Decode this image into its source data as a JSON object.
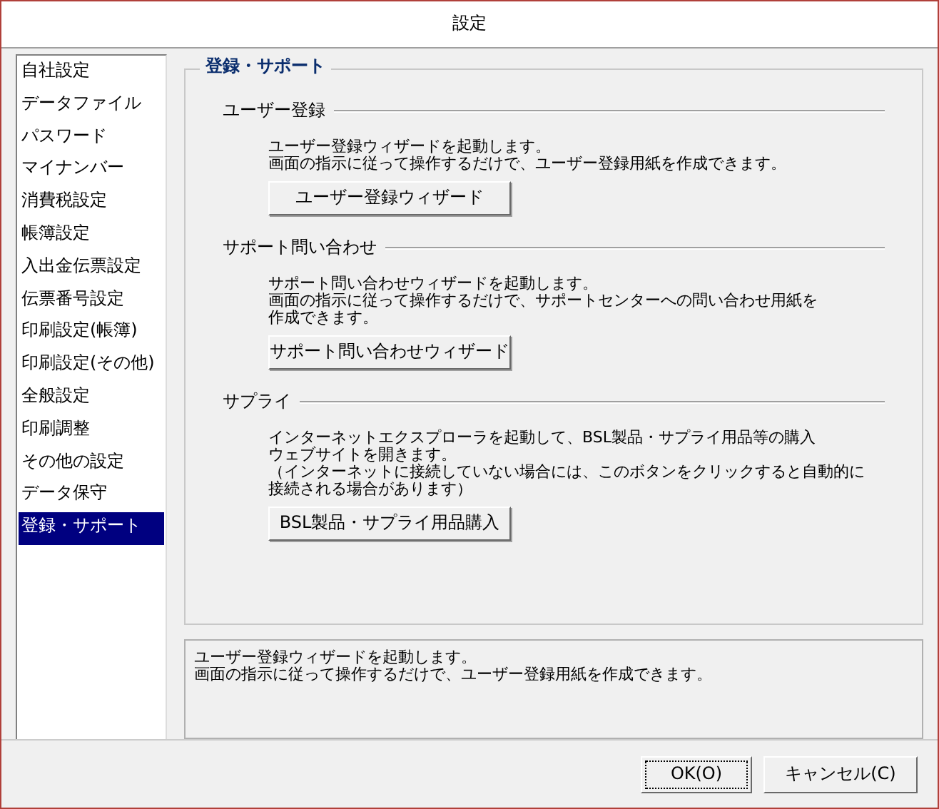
{
  "window": {
    "title": "設定"
  },
  "sidebar": {
    "items": [
      {
        "label": "自社設定",
        "selected": false
      },
      {
        "label": "データファイル",
        "selected": false
      },
      {
        "label": "パスワード",
        "selected": false
      },
      {
        "label": "マイナンバー",
        "selected": false
      },
      {
        "label": "消費税設定",
        "selected": false
      },
      {
        "label": "帳簿設定",
        "selected": false
      },
      {
        "label": "入出金伝票設定",
        "selected": false
      },
      {
        "label": "伝票番号設定",
        "selected": false
      },
      {
        "label": "印刷設定(帳簿)",
        "selected": false
      },
      {
        "label": "印刷設定(その他)",
        "selected": false
      },
      {
        "label": "全般設定",
        "selected": false
      },
      {
        "label": "印刷調整",
        "selected": false
      },
      {
        "label": "その他の設定",
        "selected": false
      },
      {
        "label": "データ保守",
        "selected": false
      },
      {
        "label": "登録・サポート",
        "selected": true
      }
    ]
  },
  "panel": {
    "title": "登録・サポート",
    "sections": [
      {
        "heading": "ユーザー登録",
        "description_lines": [
          "ユーザー登録ウィザードを起動します。",
          "画面の指示に従って操作するだけで、ユーザー登録用紙を作成できます。"
        ],
        "button": "ユーザー登録ウィザード"
      },
      {
        "heading": "サポート問い合わせ",
        "description_lines": [
          "サポート問い合わせウィザードを起動します。",
          "画面の指示に従って操作するだけで、サポートセンターへの問い合わせ用紙を",
          "作成できます。"
        ],
        "button": "サポート問い合わせウィザード"
      },
      {
        "heading": "サプライ",
        "description_lines": [
          "インターネットエクスプローラを起動して、BSL製品・サプライ用品等の購入",
          "ウェブサイトを開きます。",
          "（インターネットに接続していない場合には、このボタンをクリックすると自動的に",
          "接続される場合があります）"
        ],
        "button": "BSL製品・サプライ用品購入"
      }
    ]
  },
  "help_lines": [
    "ユーザー登録ウィザードを起動します。",
    "画面の指示に従って操作するだけで、ユーザー登録用紙を作成できます。"
  ],
  "buttons": [
    {
      "label": "OK(O)",
      "default": true
    },
    {
      "label": "キャンセル(C)",
      "default": false
    }
  ]
}
